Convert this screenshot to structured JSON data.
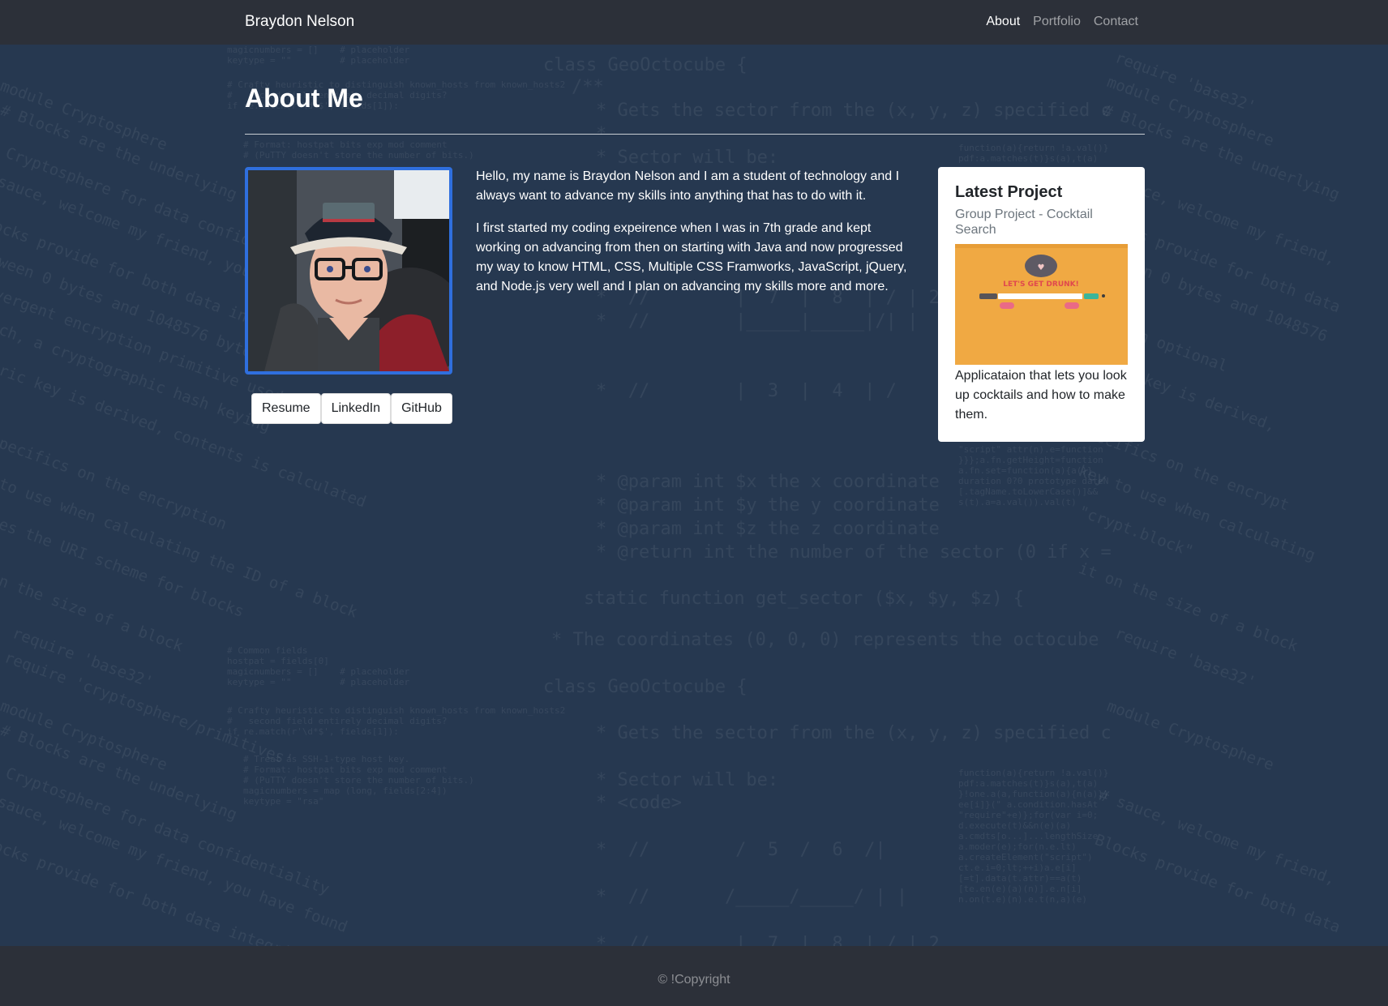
{
  "navbar": {
    "brand": "Braydon Nelson",
    "links": [
      {
        "label": "About",
        "active": true
      },
      {
        "label": "Portfolio",
        "active": false
      },
      {
        "label": "Contact",
        "active": false
      }
    ]
  },
  "main": {
    "title": "About Me",
    "bio": [
      "Hello, my name is Braydon Nelson and I am a student of technology and I always want to advance my skills into anything that has to do with it.",
      "I first started my coding expeirence when I was in 7th grade and kept working on advancing from then on starting with Java and now progressed my way to know HTML, CSS, Multiple CSS Framworks, JavaScript, jQuery, and Node.js very well and I plan on advancing my skills more and more."
    ],
    "buttons": {
      "resume": "Resume",
      "linkedin": "LinkedIn",
      "github": "GitHub"
    }
  },
  "project_card": {
    "title": "Latest Project",
    "subtitle": "Group Project - Cocktail Search",
    "image_caption": "LET'S GET DRUNK!",
    "description": "Applicataion that lets you look up cocktails and how to make them."
  },
  "footer": {
    "text": "© !Copyright"
  },
  "colors": {
    "background": "#263850",
    "navbar": "#2c3039",
    "photo_border": "#2f6fde",
    "project_image": "#f0a943"
  }
}
